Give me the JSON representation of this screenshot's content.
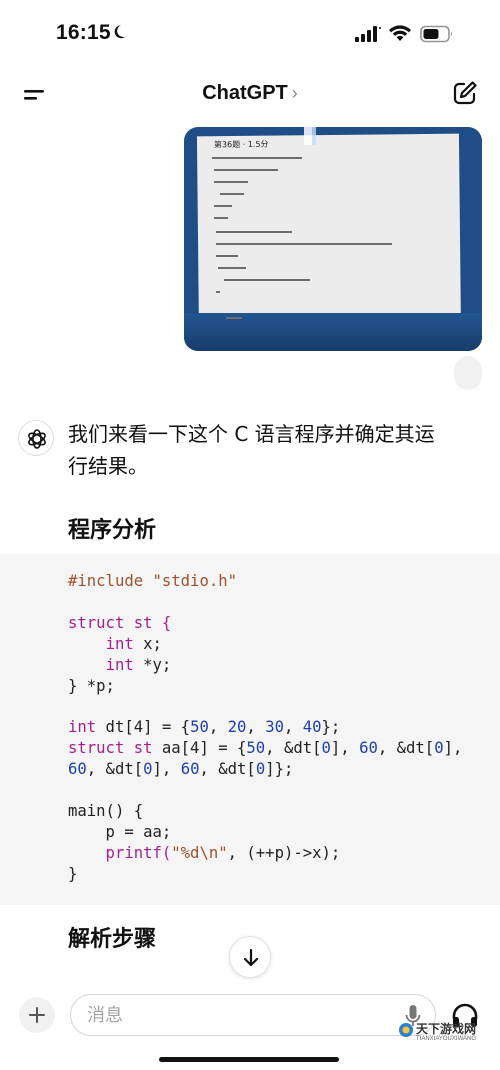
{
  "status_bar": {
    "time": "16:15",
    "icons": [
      "moon-icon",
      "signal-icon",
      "wifi-icon",
      "battery-icon"
    ]
  },
  "header": {
    "title": "ChatGPT",
    "title_chevron": "›",
    "menu_icon": "menu-icon",
    "edit_icon": "new-chat-icon"
  },
  "attachment": {
    "description_icon": "photo-attachment",
    "photo_text": "第36题 · 1.5分"
  },
  "assistant": {
    "avatar_icon": "openai-logo-icon",
    "intro": "我们来看一下这个 C 语言程序并确定其运行结果。",
    "heading_analysis": "程序分析",
    "heading_steps": "解析步骤"
  },
  "code": {
    "include_kw": "#include",
    "include_str": "\"stdio.h\"",
    "l3": "struct st {",
    "l4_type": "int",
    "l4_rest": " x;",
    "l5_type": "int",
    "l5_rest": " *y;",
    "l6": "} *p;",
    "l8_type": "int",
    "l8_rest_a": " dt[4] = {",
    "l8_n1": "50",
    "l8_n2": "20",
    "l8_n3": "30",
    "l8_n4": "40",
    "l8_end": "};",
    "l9_kw": "struct st",
    "l9_a": " aa[4] = {",
    "l9_n1": "50",
    "l9_b": ", &dt[",
    "l9_i1": "0",
    "l9_c": "], ",
    "l9_n2": "60",
    "l9_d": ", &dt[",
    "l9_i2": "0",
    "l9_e": "],",
    "l10_n1": "60",
    "l10_a": ", &dt[",
    "l10_i1": "0",
    "l10_b": "], ",
    "l10_n2": "60",
    "l10_c": ", &dt[",
    "l10_i2": "0",
    "l10_d": "]};",
    "l12": "main() {",
    "l13": "    p = aa;",
    "l14_fn": "    printf(",
    "l14_str": "\"%d\\n\"",
    "l14_rest": ", (++p)->x);",
    "l15": "}"
  },
  "composer": {
    "placeholder": "消息",
    "plus_icon": "plus-icon",
    "mic_icon": "microphone-icon",
    "voice_icon": "headphones-icon"
  },
  "scroll_button_icon": "arrow-down-icon",
  "watermark": {
    "text": "天下游戏网",
    "sub": "TIANXIAYOUXIWANG"
  }
}
